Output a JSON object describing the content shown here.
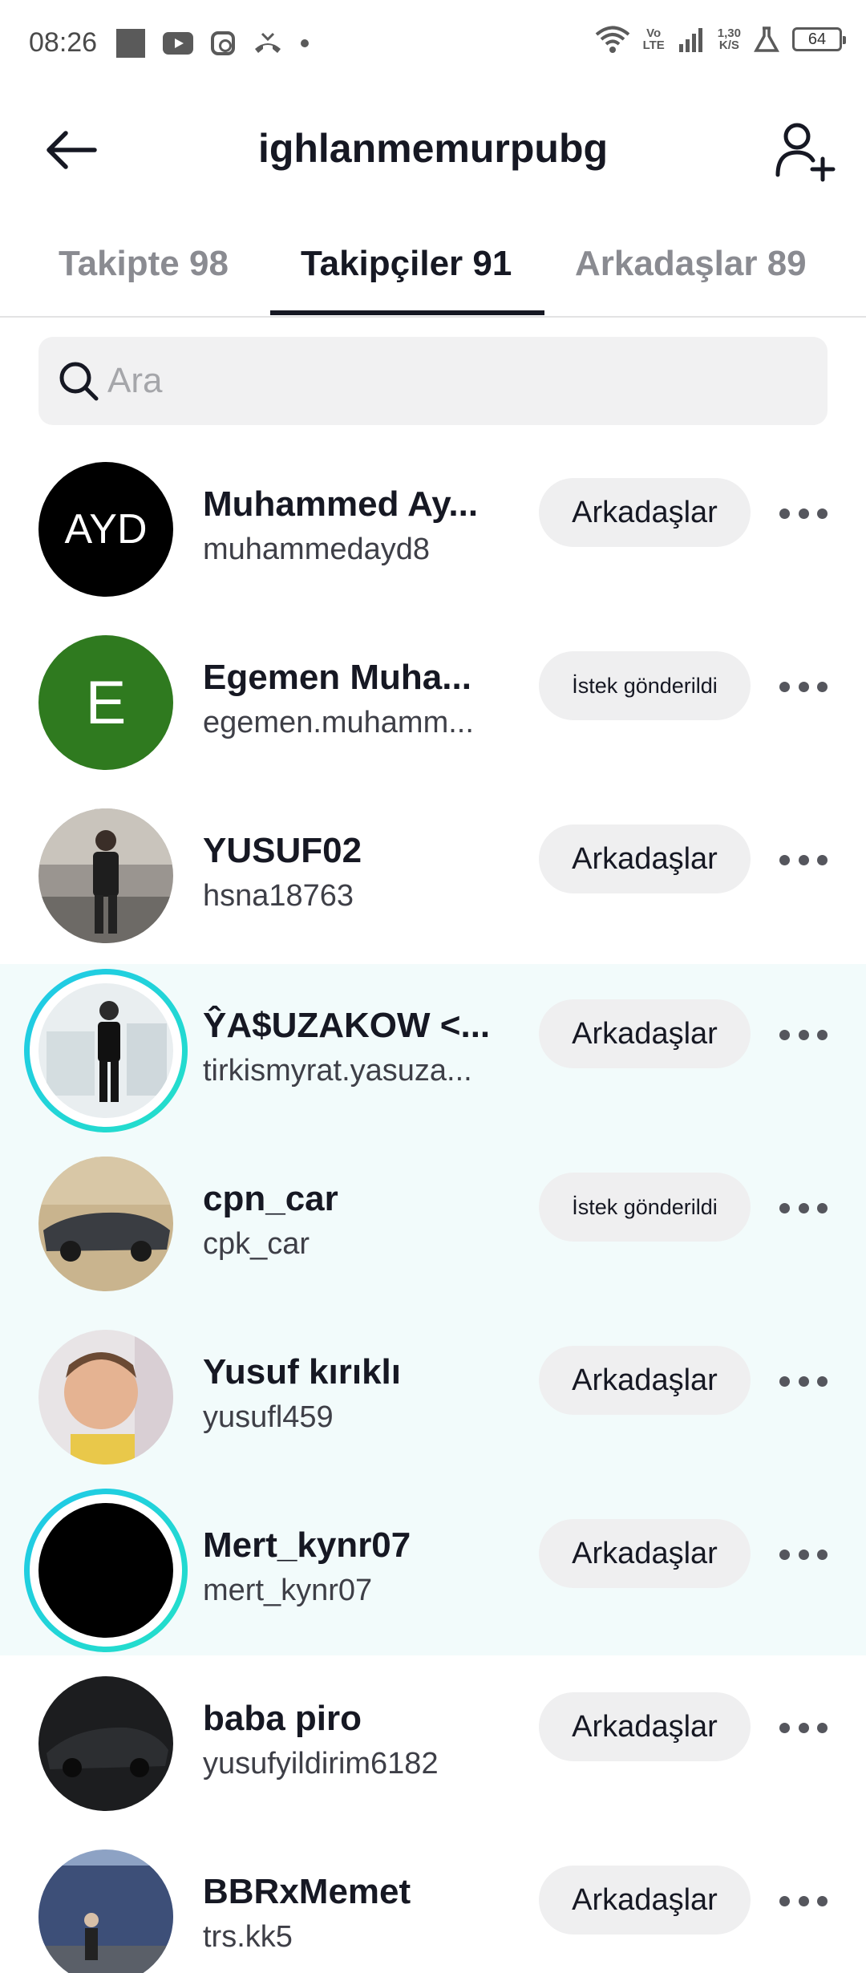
{
  "status_bar": {
    "time": "08:26",
    "net_top": "Vo",
    "net_bottom": "LTE",
    "speed_top": "1,30",
    "speed_bottom": "K/S",
    "battery": "64"
  },
  "header": {
    "title": "ighlanmemurpubg"
  },
  "tabs": [
    {
      "label": "Takipte 98"
    },
    {
      "label": "Takipçiler 91"
    },
    {
      "label": "Arkadaşlar 89"
    }
  ],
  "search": {
    "placeholder": "Ara"
  },
  "users": [
    {
      "name": "Muhammed Ay...",
      "handle": "muhammedayd8",
      "button": "Arkadaşlar",
      "avatar_text": "AYD"
    },
    {
      "name": "Egemen Muha...",
      "handle": "egemen.muhamm...",
      "button": "İstek gönderildi",
      "avatar_text": "E"
    },
    {
      "name": "YUSUF02",
      "handle": "hsna18763",
      "button": "Arkadaşlar"
    },
    {
      "name": "ŶA$UZAKOW <...",
      "handle": "tirkismyrat.yasuza...",
      "button": "Arkadaşlar"
    },
    {
      "name": "cpn_car",
      "handle": "cpk_car",
      "button": "İstek gönderildi"
    },
    {
      "name": "Yusuf kırıklı",
      "handle": "yusufl459",
      "button": "Arkadaşlar"
    },
    {
      "name": "Mert_kynr07",
      "handle": "mert_kynr07",
      "button": "Arkadaşlar"
    },
    {
      "name": "baba piro",
      "handle": "yusufyildirim6182",
      "button": "Arkadaşlar"
    },
    {
      "name": "BBRxMemet",
      "handle": "trs.kk5",
      "button": "Arkadaşlar"
    }
  ],
  "colors": {
    "active_tab": "#161823",
    "inactive_tab": "#8a8b91",
    "highlight_band": "#f2fbfb",
    "story_ring": "#1fc8e8",
    "button_bg": "#efeff0"
  }
}
